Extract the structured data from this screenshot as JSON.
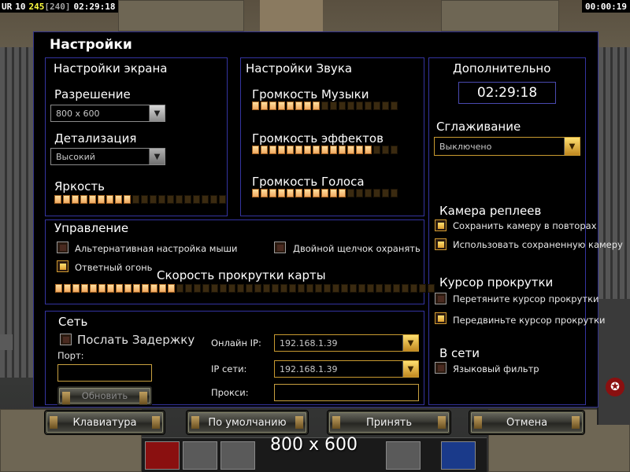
{
  "hud": {
    "player": "UR",
    "level": "10",
    "money": "245",
    "power": "[240]",
    "game_time": "02:29:18",
    "right_time": "00:00:19"
  },
  "dialog": {
    "title": "Настройки",
    "screen": {
      "title": "Настройки экрана",
      "resolution_label": "Разрешение",
      "resolution_value": "800 x 600",
      "detail_label": "Детализация",
      "detail_value": "Высокий",
      "brightness_label": "Яркость",
      "brightness_level": 9,
      "brightness_segments": 20
    },
    "sound": {
      "title": "Настройки Звука",
      "music_label": "Громкость Музыки",
      "music_level": 8,
      "effects_label": "Громкость эффектов",
      "effects_level": 14,
      "voice_label": "Громкость Голоса",
      "voice_level": 11,
      "segments": 17
    },
    "extra": {
      "title": "Дополнительно",
      "clock": "02:29:18",
      "antialias_label": "Сглаживание",
      "antialias_value": "Выключено",
      "replay_camera_label": "Камера реплеев",
      "save_camera": "Сохранить камеру в повторах",
      "save_camera_checked": true,
      "use_saved_camera": "Использовать сохраненную камеру",
      "use_saved_camera_checked": true,
      "scroll_cursor_label": "Курсор прокрутки",
      "drag_cursor": "Перетяните курсор прокрутки",
      "drag_cursor_checked": false,
      "move_cursor": "Передвиньте курсор прокрутки",
      "move_cursor_checked": true,
      "online_label": "В сети",
      "language_filter": "Языковый фильтр",
      "language_filter_checked": false
    },
    "control": {
      "title": "Управление",
      "alt_mouse": "Альтернативная настройка мыши",
      "alt_mouse_checked": false,
      "double_click": "Двойной щелчок охранять",
      "double_click_checked": false,
      "return_fire": "Ответный огонь",
      "return_fire_checked": true,
      "scroll_speed_label": "Скорость прокрутки карты",
      "scroll_speed_level": 14,
      "segments": 44
    },
    "network": {
      "title": "Сеть",
      "send_delay": "Послать Задержку",
      "send_delay_checked": false,
      "port_label": "Порт:",
      "port_value": "",
      "refresh_button": "Обновить",
      "online_ip_label": "Онлайн IP:",
      "online_ip_value": "192.168.1.39",
      "lan_ip_label": "IP сети:",
      "lan_ip_value": "192.168.1.39",
      "proxy_label": "Прокси:",
      "proxy_value": ""
    },
    "buttons": {
      "keyboard": "Клавиатура",
      "defaults": "По умолчанию",
      "accept": "Принять",
      "cancel": "Отмена"
    }
  },
  "overlay": {
    "resolution_text": "800 x 600"
  },
  "colors": {
    "dialog_border": "#30308a",
    "accent_gold": "#e0a030",
    "slider_on": "#f0a860"
  }
}
